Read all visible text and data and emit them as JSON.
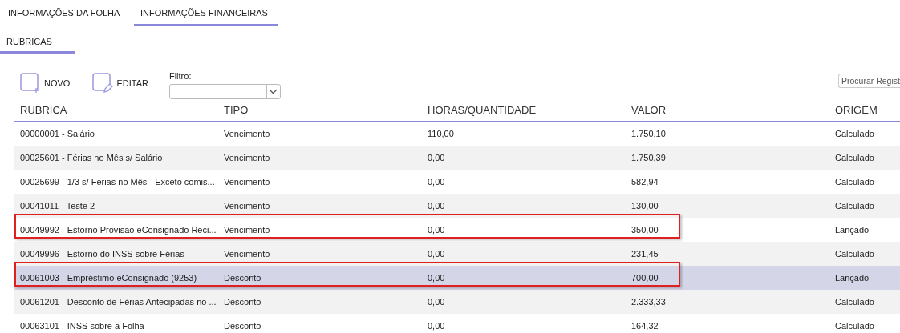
{
  "tabs": [
    {
      "label": "INFORMAÇÕES DA FOLHA",
      "selected": false
    },
    {
      "label": "INFORMAÇÕES FINANCEIRAS",
      "selected": true
    }
  ],
  "subtabs": [
    {
      "label": "RUBRICAS",
      "selected": true
    }
  ],
  "toolbar": {
    "buttons": [
      {
        "kind": "new",
        "label": "NOVO"
      },
      {
        "kind": "edit",
        "label": "EDITAR"
      }
    ],
    "filter_label": "Filtro:",
    "search": {
      "placeholder": "Procurar Regist"
    }
  },
  "table": {
    "columns": [
      "RUBRICA",
      "TIPO",
      "HORAS/QUANTIDADE",
      "VALOR",
      "ORIGEM"
    ],
    "rows": [
      {
        "cells": [
          "00000001 - Salário",
          "Vencimento",
          "110,00",
          "1.750,10",
          "Calculado"
        ],
        "selected": false,
        "highlighted": false
      },
      {
        "cells": [
          "00025601 - Férias no Mês s/ Salário",
          "Vencimento",
          "0,00",
          "1.750,39",
          "Calculado"
        ],
        "selected": false,
        "highlighted": false
      },
      {
        "cells": [
          "00025699 - 1/3 s/ Férias no Mês - Exceto comis...",
          "Vencimento",
          "0,00",
          "582,94",
          "Calculado"
        ],
        "selected": false,
        "highlighted": false
      },
      {
        "cells": [
          "00041011 - Teste 2",
          "Vencimento",
          "0,00",
          "130,00",
          "Calculado"
        ],
        "selected": false,
        "highlighted": false
      },
      {
        "cells": [
          "00049992 - Estorno Provisão eConsignado Reci...",
          "Vencimento",
          "0,00",
          "350,00",
          "Lançado"
        ],
        "selected": false,
        "highlighted": true
      },
      {
        "cells": [
          "00049996 - Estorno do INSS sobre Férias",
          "Vencimento",
          "0,00",
          "231,45",
          "Calculado"
        ],
        "selected": false,
        "highlighted": false
      },
      {
        "cells": [
          "00061003 - Empréstimo eConsignado (9253)",
          "Desconto",
          "0,00",
          "700,00",
          "Lançado"
        ],
        "selected": true,
        "highlighted": true
      },
      {
        "cells": [
          "00061201 - Desconto de Férias Antecipadas no ...",
          "Desconto",
          "0,00",
          "2.333,33",
          "Calculado"
        ],
        "selected": false,
        "highlighted": false
      },
      {
        "cells": [
          "00063101 - INSS sobre a Folha",
          "Desconto",
          "0,00",
          "164,32",
          "Calculado"
        ],
        "selected": false,
        "highlighted": false
      }
    ]
  }
}
